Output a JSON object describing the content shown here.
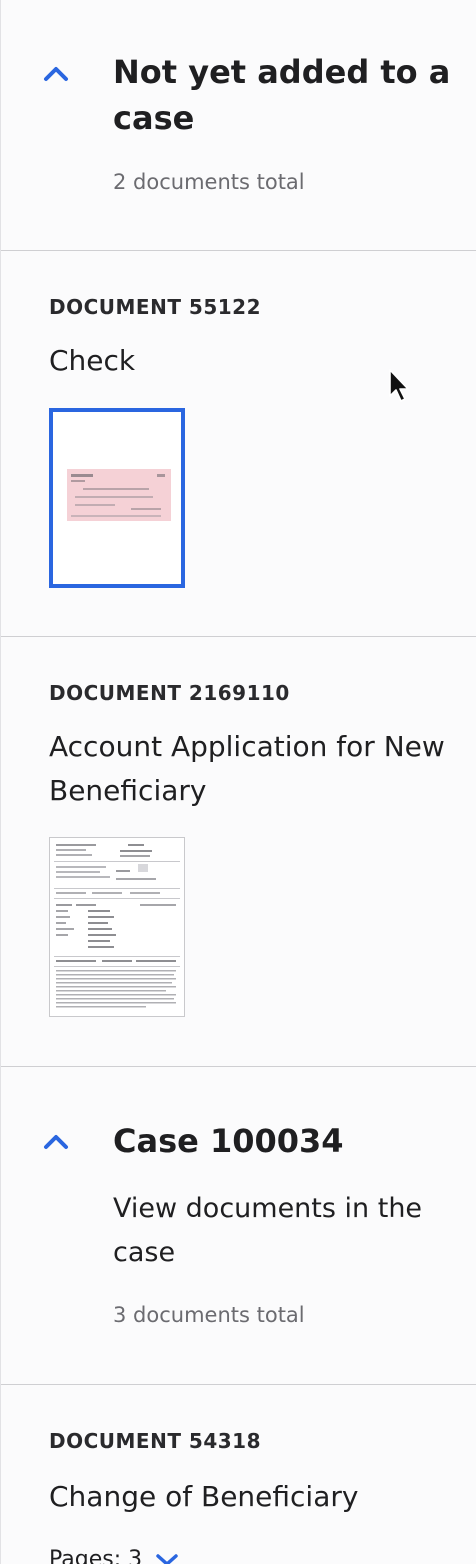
{
  "groups": [
    {
      "title": "Not yet added to a case",
      "subtitle": "",
      "count": "2 documents total",
      "documents": [
        {
          "id": "DOCUMENT 55122",
          "title": "Check"
        },
        {
          "id": "DOCUMENT 2169110",
          "title": "Account Application for New Beneficiary"
        }
      ]
    },
    {
      "title": "Case 100034",
      "subtitle": "View documents in the case",
      "count": "3 documents total",
      "documents": [
        {
          "id": "DOCUMENT 54318",
          "title": "Change of Beneficiary",
          "pages": "Pages: 3"
        }
      ]
    }
  ],
  "icons": {
    "collapse": "chevron-up-icon",
    "expand": "chevron-down-icon",
    "cursor": "mouse-pointer-icon"
  },
  "colors": {
    "accent": "#2a66e0",
    "divider": "#cfcfd2",
    "muted_text": "#6b6b70",
    "check_tint": "#f3c9cf"
  }
}
